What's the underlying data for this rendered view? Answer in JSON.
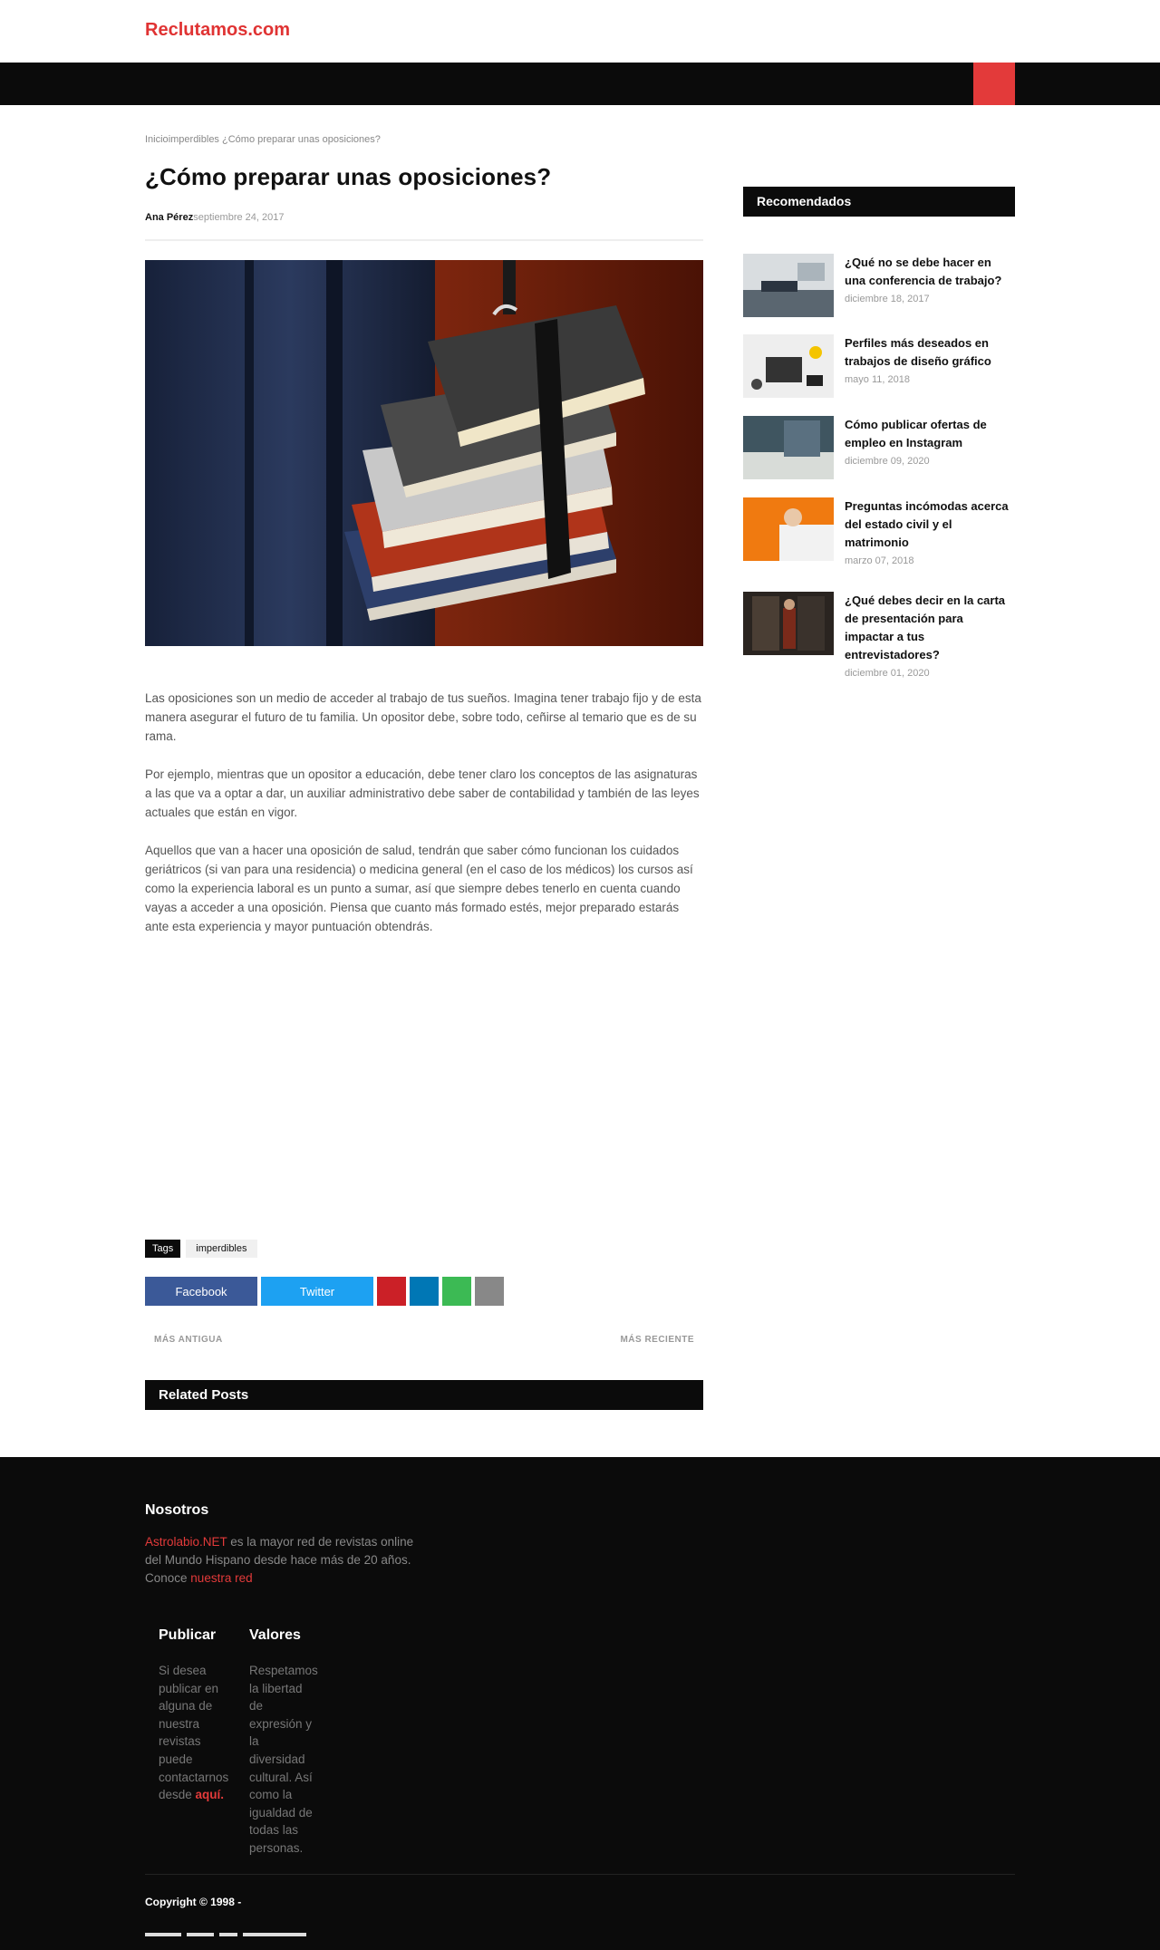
{
  "header": {
    "logo": "Reclutamos.com"
  },
  "breadcrumb": {
    "home": "Inicio",
    "category": "imperdibles",
    "current": "¿Cómo preparar unas oposiciones?"
  },
  "article": {
    "title": "¿Cómo preparar unas oposiciones?",
    "author": "Ana Pérez",
    "date": "septiembre 24, 2017",
    "paragraphs": [
      "Las oposiciones son un medio de acceder al trabajo de tus sueños. Imagina tener trabajo fijo y de esta manera asegurar el futuro de tu familia. Un opositor debe, sobre todo, ceñirse al temario que es de su rama.",
      "Por ejemplo, mientras que un opositor a educación, debe tener claro los conceptos de las asignaturas a las que va a optar a dar, un auxiliar administrativo debe saber de contabilidad y también de las leyes actuales que están en vigor.",
      "Aquellos que van a hacer una oposición de salud, tendrán que saber cómo funcionan los cuidados geriátricos (si van para una residencia) o medicina general (en el caso de los médicos) los cursos así como la experiencia laboral es un punto a sumar, así que siempre debes tenerlo en cuenta cuando vayas a acceder a una oposición. Piensa que cuanto más formado estés, mejor preparado estarás ante esta experiencia y mayor puntuación obtendrás."
    ]
  },
  "tags": {
    "label": "Tags",
    "items": [
      "imperdibles"
    ]
  },
  "share": {
    "facebook": "Facebook",
    "twitter": "Twitter"
  },
  "pager": {
    "older": "MÁS ANTIGUA",
    "newer": "MÁS RECIENTE"
  },
  "related": {
    "title": "Related Posts"
  },
  "sidebar": {
    "title": "Recomendados",
    "items": [
      {
        "title": "¿Qué no se debe hacer en una conferencia de trabajo?",
        "date": "diciembre 18, 2017"
      },
      {
        "title": "Perfiles más deseados en trabajos de diseño gráfico",
        "date": "mayo 11, 2018"
      },
      {
        "title": "Cómo publicar ofertas de empleo en Instagram",
        "date": "diciembre 09, 2020"
      },
      {
        "title": "Preguntas incómodas acerca del estado civil y el matrimonio",
        "date": "marzo 07, 2018"
      },
      {
        "title": "¿Qué debes decir en la carta de presentación para impactar a tus entrevistadores?",
        "date": "diciembre 01, 2020"
      }
    ]
  },
  "footer": {
    "nosotros_title": "Nosotros",
    "about_link": "Astrolabio.NET",
    "about_text": " es la mayor red de revistas online del Mundo Hispano desde hace más de 20 años.",
    "conoce": "Conoce ",
    "network_link": "nuestra red",
    "publicar_title": "Publicar",
    "publicar_text": "Si desea publicar en alguna de nuestra revistas puede contactarnos desde ",
    "publicar_link": "aquí.",
    "valores_title": "Valores",
    "valores_text": "Respetamos la libertad de expresión y la diversidad cultural. Así como la igualdad de todas las personas.",
    "copyright": "Copyright © 1998 -"
  }
}
